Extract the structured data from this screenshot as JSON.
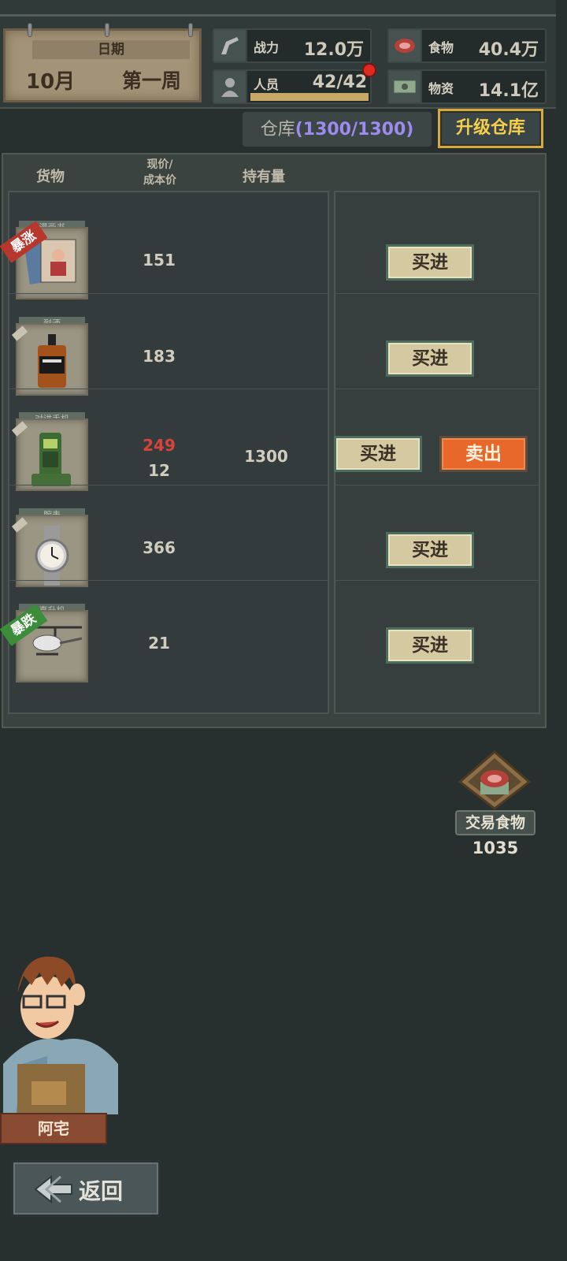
{
  "date": {
    "label": "日期",
    "month": "10月",
    "week": "第一周"
  },
  "stats": {
    "power": {
      "label": "战力",
      "value": "12.0万",
      "icon": "gun-icon"
    },
    "personnel": {
      "label": "人员",
      "value": "42/42",
      "icon": "person-icon",
      "fill": 1.0
    },
    "food": {
      "label": "食物",
      "value": "40.4万",
      "icon": "meat-icon"
    },
    "supplies": {
      "label": "物资",
      "value": "14.1亿",
      "icon": "money-icon"
    }
  },
  "warehouse": {
    "label": "仓库",
    "amount": "(1300/1300)",
    "upgrade_label": "升级仓库"
  },
  "table": {
    "headers": {
      "goods": "货物",
      "price_line1": "现价/",
      "price_line2": "成本价",
      "holding": "持有量"
    },
    "rows": [
      {
        "name": "漫画书",
        "price": "151",
        "cost": "",
        "holding": "",
        "tag": "暴涨",
        "buy": "买进",
        "sell": "",
        "icon": "comic-book-icon"
      },
      {
        "name": "烈酒",
        "price": "183",
        "cost": "",
        "holding": "",
        "tag": "",
        "buy": "买进",
        "sell": "",
        "icon": "whiskey-bottle-icon"
      },
      {
        "name": "对讲手机",
        "price": "249",
        "cost": "12",
        "holding": "1300",
        "tag": "",
        "buy": "买进",
        "sell": "卖出",
        "icon": "walkie-talkie-icon"
      },
      {
        "name": "腕表",
        "price": "366",
        "cost": "",
        "holding": "",
        "tag": "",
        "buy": "买进",
        "sell": "",
        "icon": "wristwatch-icon"
      },
      {
        "name": "直升机",
        "price": "21",
        "cost": "",
        "holding": "",
        "tag": "暴跌",
        "buy": "买进",
        "sell": "",
        "icon": "helicopter-icon"
      }
    ]
  },
  "trade": {
    "label": "交易食物",
    "count": "1035"
  },
  "npc": {
    "name": "阿宅"
  },
  "back": {
    "label": "返回"
  },
  "colors": {
    "gold": "#f6cf4a",
    "sell": "#e8682c",
    "price_up": "#d8433c",
    "warehouse_count": "#9e8bf0"
  }
}
